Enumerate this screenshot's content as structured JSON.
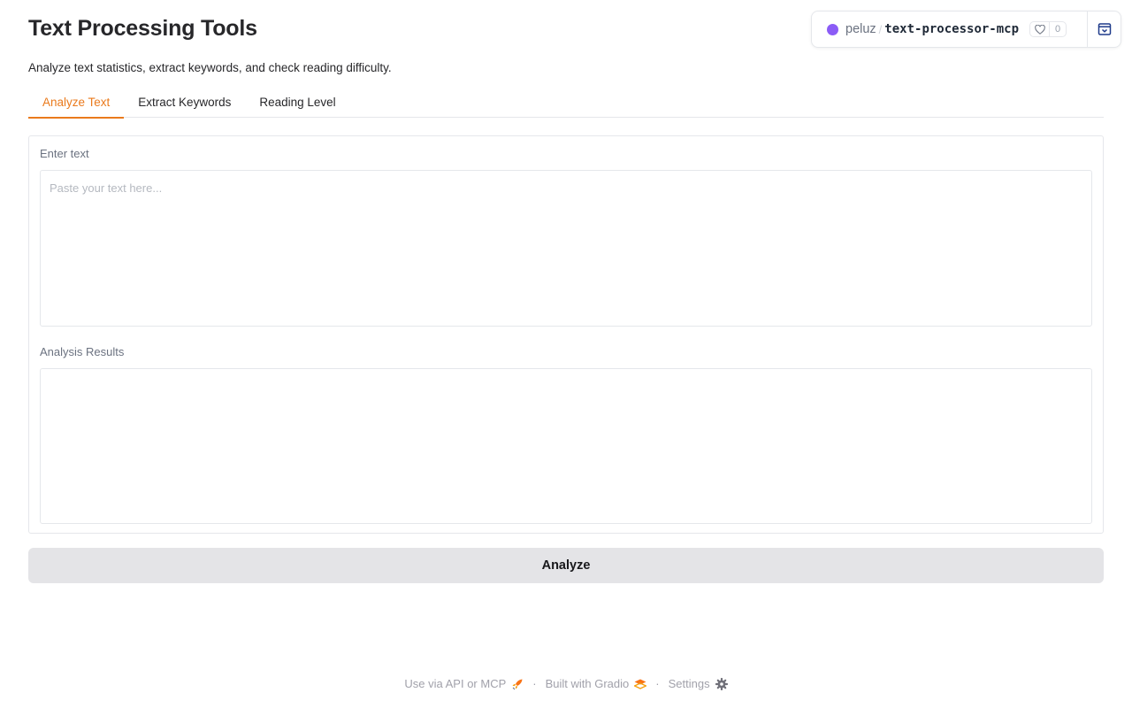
{
  "header": {
    "title": "Text Processing Tools",
    "description": "Analyze text statistics, extract keywords, and check reading difficulty."
  },
  "space": {
    "owner": "peluz",
    "repo": "text-processor-mcp",
    "likes": "0",
    "dot_color": "#8b5cf6"
  },
  "tabs": [
    {
      "label": "Analyze Text",
      "active": true
    },
    {
      "label": "Extract Keywords",
      "active": false
    },
    {
      "label": "Reading Level",
      "active": false
    }
  ],
  "input": {
    "label": "Enter text",
    "placeholder": "Paste your text here...",
    "value": ""
  },
  "output": {
    "label": "Analysis Results",
    "value": ""
  },
  "actions": {
    "analyze_label": "Analyze"
  },
  "footer": {
    "api_label": "Use via API or MCP",
    "built_label": "Built with Gradio",
    "settings_label": "Settings"
  },
  "colors": {
    "accent": "#ea7a1c",
    "button_bg": "#e4e4e7"
  }
}
